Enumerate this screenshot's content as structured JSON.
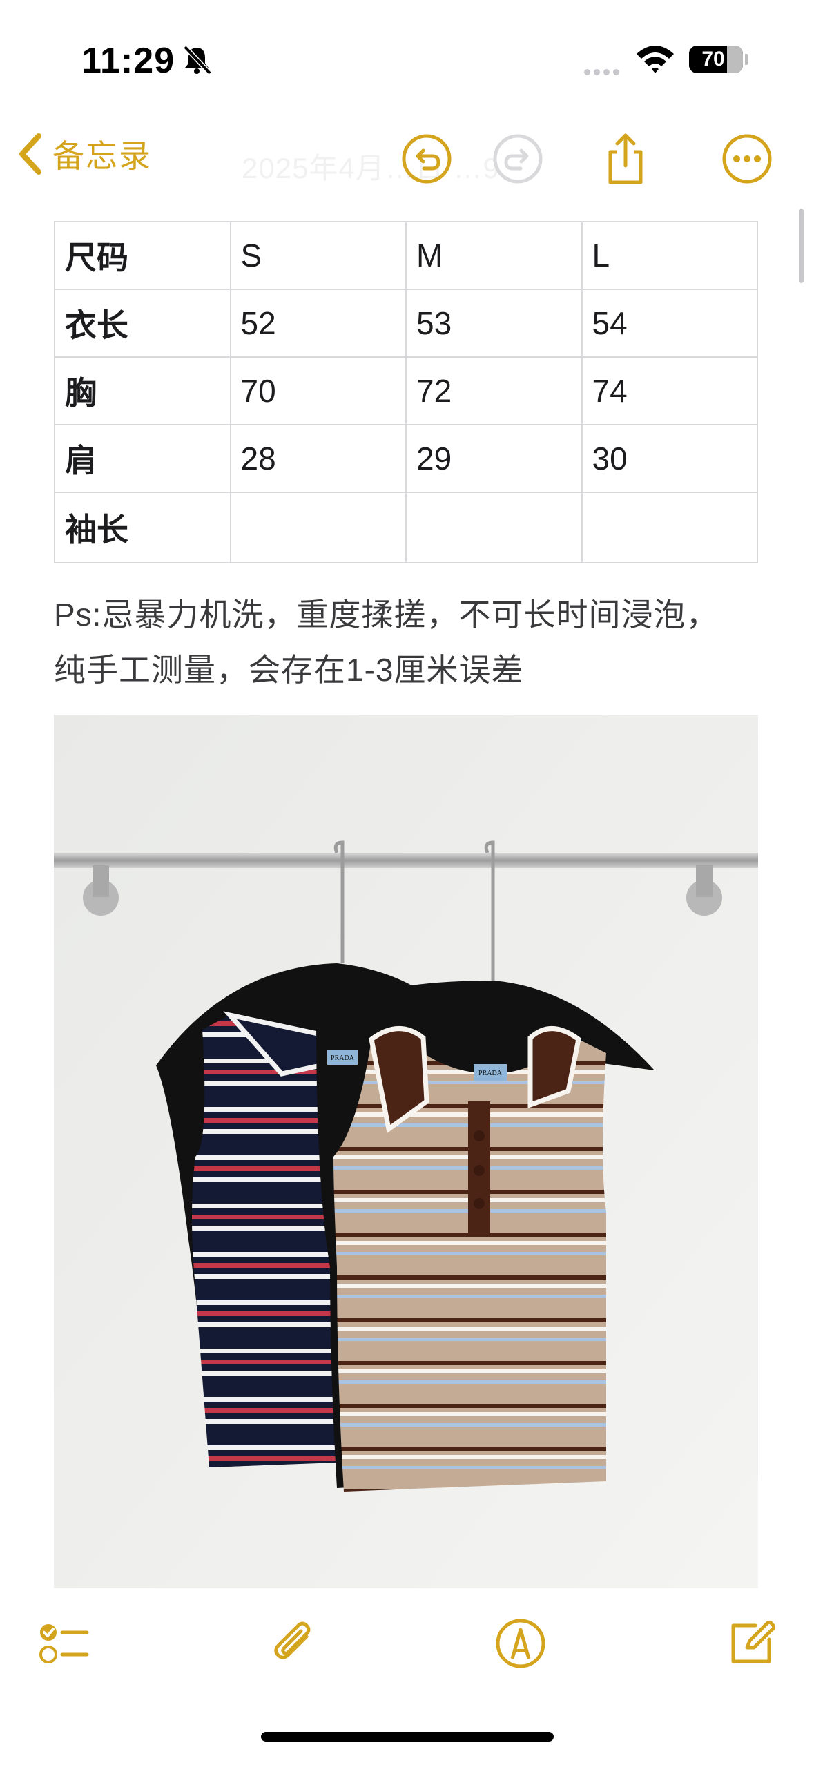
{
  "status_bar": {
    "time": "11:29",
    "battery": "70",
    "battery_level": 0.7
  },
  "nav": {
    "back_label": "备忘录",
    "faded_date": "2025年4月…日 …9",
    "accent": "#d4a41c"
  },
  "size_table": {
    "rows": [
      [
        "尺码",
        "S",
        "M",
        "L"
      ],
      [
        "衣长",
        "52",
        "53",
        "54"
      ],
      [
        "胸",
        "70",
        "72",
        "74"
      ],
      [
        "肩",
        "28",
        "29",
        "30"
      ],
      [
        "袖长",
        "",
        "",
        ""
      ]
    ]
  },
  "note": {
    "line1": "Ps:忌暴力机洗，重度揉搓，不可长时间浸泡，",
    "line2": "纯手工测量，会存在1-3厘米误差"
  },
  "photo": {
    "brand_label_1": "PRADA",
    "brand_label_2": "PRADA"
  },
  "icons": {
    "undo": "undo-icon",
    "redo": "redo-icon",
    "share": "share-icon",
    "more": "more-icon",
    "checklist": "checklist-icon",
    "attachment": "paperclip-icon",
    "markup": "markup-pen-icon",
    "compose": "compose-icon"
  }
}
